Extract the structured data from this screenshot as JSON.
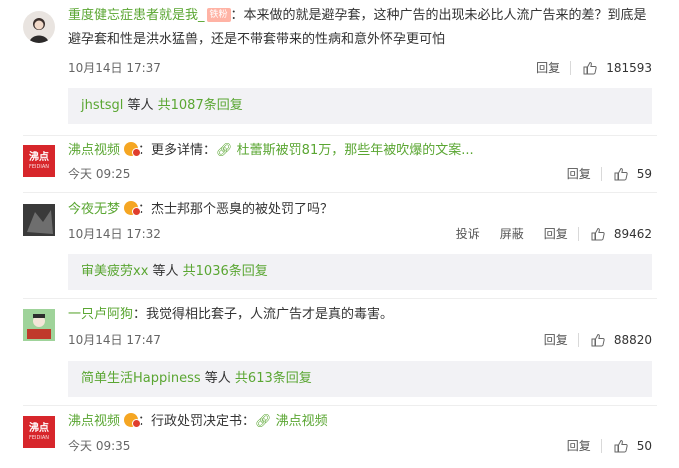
{
  "comments": [
    {
      "user": "重度健忘症患者就是我_",
      "badge": "铁粉",
      "text": "：本来做的就是避孕套，这种广告的出现未必比人流广告来的差？到底是避孕套和性是洪水猛兽，还是不带套带来的性病和意外怀孕更可怕",
      "time": "10月14日 17:37",
      "reply": "回复",
      "likes": "181593",
      "replies_user": "jhstsgl",
      "replies_mid": " 等人 ",
      "replies_count": "共1087条回复"
    },
    {
      "user": "沸点视频",
      "text_prefix": "：更多详情：",
      "link": " 杜蕾斯被罚81万，那些年被吹爆的文案...",
      "time": "今天 09:25",
      "reply": "回复",
      "likes": "59"
    },
    {
      "user": "今夜无梦",
      "text": "：杰士邦那个恶臭的被处罚了吗？",
      "time": "10月14日 17:32",
      "report": "投诉",
      "block": "屏蔽",
      "reply": "回复",
      "likes": "89462",
      "replies_user": "审美疲劳xx",
      "replies_mid": " 等人 ",
      "replies_count": "共1036条回复"
    },
    {
      "user": "一只卢阿狗",
      "text": "：我觉得相比套子，人流广告才是真的毒害。",
      "time": "10月14日 17:47",
      "reply": "回复",
      "likes": "88820",
      "replies_user": "简单生活Happiness",
      "replies_mid": " 等人 ",
      "replies_count": "共613条回复"
    },
    {
      "user": "沸点视频",
      "text_prefix": "：行政处罚决定书：",
      "link": " 沸点视频",
      "time": "今天 09:35",
      "reply": "回复",
      "likes": "50"
    }
  ],
  "brand_avatar": {
    "main": "沸点",
    "sub": "FEIDIAN"
  },
  "colors": {
    "username": "#eb7350",
    "link": "#5aa632",
    "brand": "#d7262b",
    "reply_box": "#f2f2f5"
  }
}
